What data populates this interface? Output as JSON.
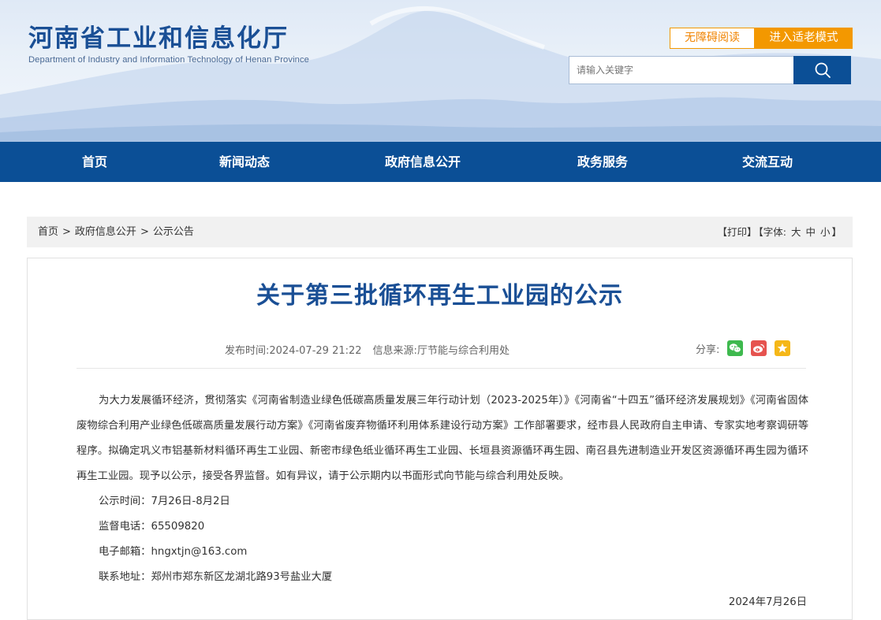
{
  "header": {
    "logo_cn": "河南省工业和信息化厅",
    "logo_en": "Department of Industry and Information Technology of Henan Province",
    "accessible_label": "无障碍阅读",
    "elder_mode_label": "进入适老模式",
    "search_placeholder": "请输入关键字",
    "search_icon": "search-icon"
  },
  "nav": {
    "items": [
      {
        "label": "首页"
      },
      {
        "label": "新闻动态"
      },
      {
        "label": "政府信息公开"
      },
      {
        "label": "政务服务"
      },
      {
        "label": "交流互动"
      }
    ]
  },
  "breadcrumb": {
    "items": [
      "首页",
      "政府信息公开",
      "公示公告"
    ],
    "separator": ">"
  },
  "tools": {
    "print": "【打印】",
    "font_prefix": "【字体:",
    "font_large": "大",
    "font_medium": "中",
    "font_small": "小",
    "font_suffix": "】"
  },
  "article": {
    "title": "关于第三批循环再生工业园的公示",
    "publish_label": "发布时间:",
    "publish_time": "2024-07-29 21:22",
    "source_label": "信息来源:",
    "source": "厅节能与综合利用处",
    "share_label": "分享:",
    "share_icons": [
      "wechat-icon",
      "weibo-icon",
      "qzone-icon"
    ],
    "paragraph": "为大力发展循环经济，贯彻落实《河南省制造业绿色低碳高质量发展三年行动计划（2023-2025年）》《河南省“十四五”循环经济发展规划》《河南省固体废物综合利用产业绿色低碳高质量发展行动方案》《河南省废弃物循环利用体系建设行动方案》工作部署要求，经市县人民政府自主申请、专家实地考察调研等程序。拟确定巩义市铝基新材料循环再生工业园、新密市绿色纸业循环再生工业园、长垣县资源循环再生园、南召县先进制造业开发区资源循环再生园为循环再生工业园。现予以公示，接受各界监督。如有异议，请于公示期内以书面形式向节能与综合利用处反映。",
    "period": "公示时间：7月26日-8月2日",
    "phone": "监督电话：65509820",
    "email": "电子邮箱：hngxtjn@163.com",
    "address": "联系地址：郑州市郑东新区龙湖北路93号盐业大厦",
    "date": "2024年7月26日"
  },
  "colors": {
    "brand_blue": "#0b4f96",
    "title_blue": "#1a4f95",
    "accent_orange": "#f39800",
    "wechat_green": "#3eb94e",
    "weibo_red": "#e6534f",
    "qzone_yellow": "#f5b718"
  }
}
